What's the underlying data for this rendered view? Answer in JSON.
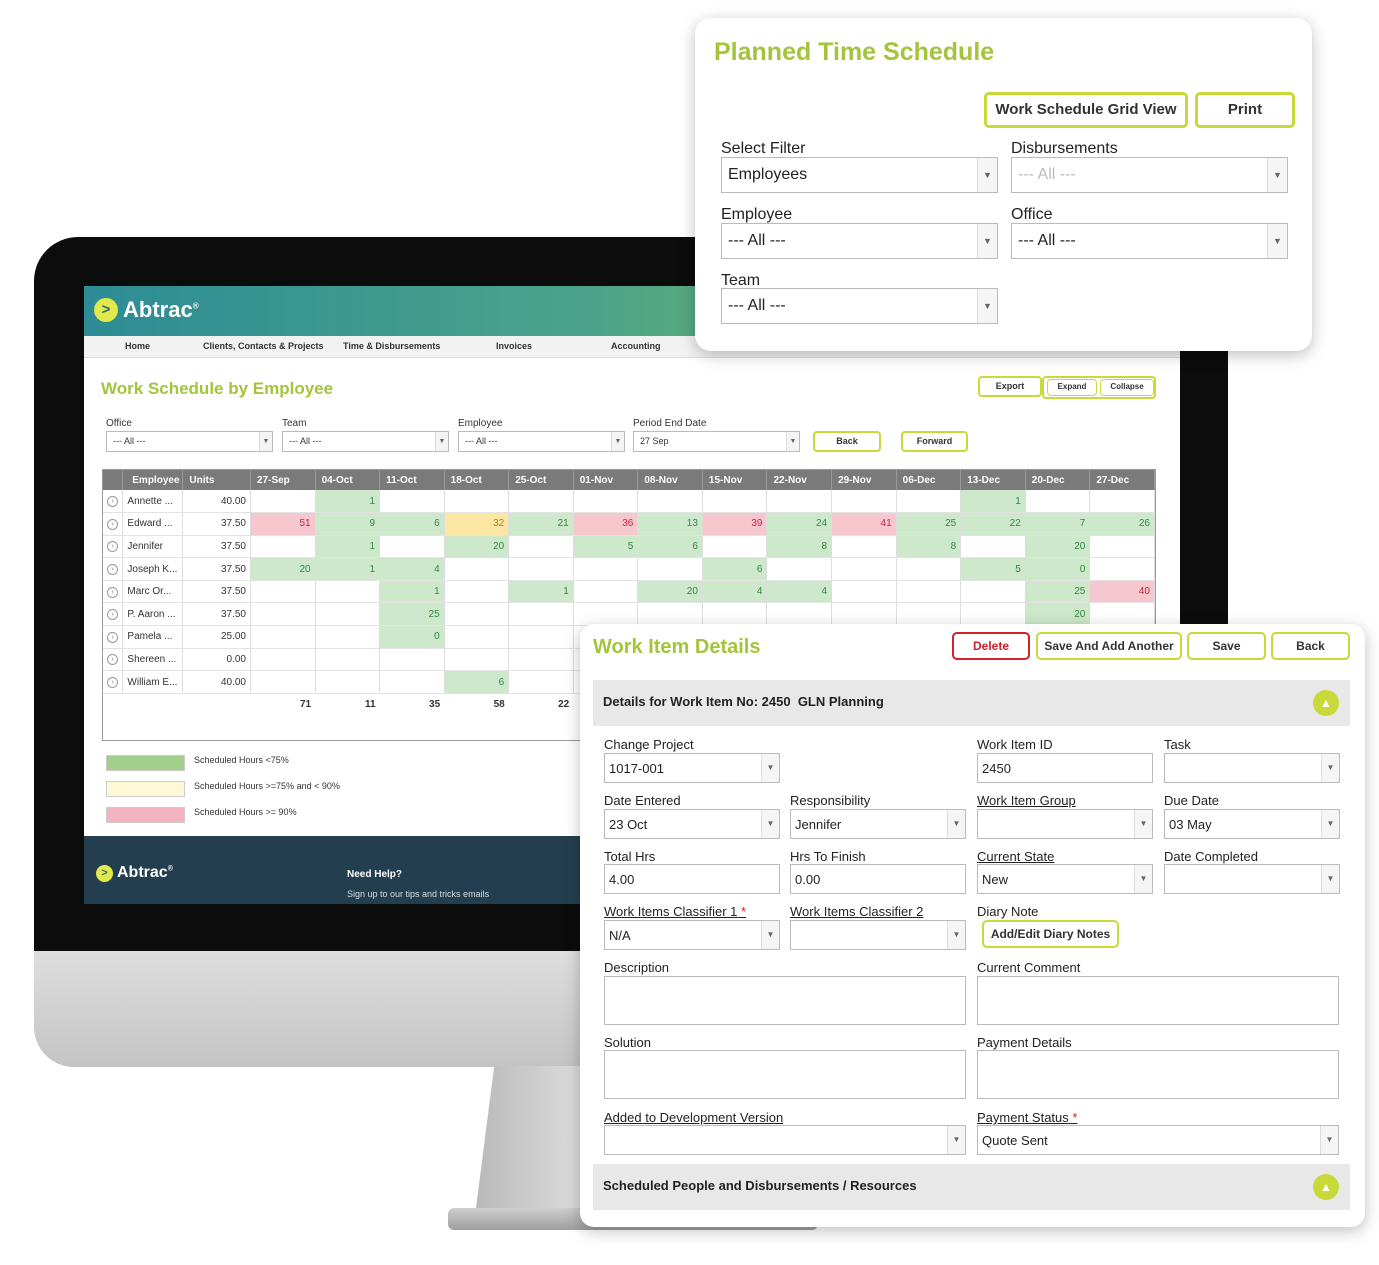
{
  "brand": {
    "name": "Abtrac",
    "reg": "®"
  },
  "nav": [
    "Home",
    "Clients, Contacts & Projects",
    "Time & Disbursements",
    "Invoices",
    "Accounting"
  ],
  "schedule": {
    "title": "Work Schedule by Employee",
    "buttons": {
      "export": "Export",
      "expand": "Expand",
      "collapse": "Collapse",
      "back": "Back",
      "forward": "Forward"
    },
    "filters": [
      {
        "label": "Office",
        "value": "--- All ---"
      },
      {
        "label": "Team",
        "value": "--- All ---"
      },
      {
        "label": "Employee",
        "value": "--- All ---"
      },
      {
        "label": "Period End Date",
        "value": "27 Sep"
      }
    ],
    "columns": [
      "Employee",
      "Units",
      "27-Sep",
      "04-Oct",
      "11-Oct",
      "18-Oct",
      "25-Oct",
      "01-Nov",
      "08-Nov",
      "15-Nov",
      "22-Nov",
      "29-Nov",
      "06-Dec",
      "13-Dec",
      "20-Dec",
      "27-Dec"
    ],
    "rows": [
      {
        "name": "Annette ...",
        "units": "40.00",
        "cells": [
          [
            "",
            ""
          ],
          [
            "1",
            "g"
          ],
          [
            "",
            ""
          ],
          [
            "",
            ""
          ],
          [
            "",
            ""
          ],
          [
            "",
            ""
          ],
          [
            "",
            ""
          ],
          [
            "",
            ""
          ],
          [
            "",
            ""
          ],
          [
            "",
            ""
          ],
          [
            "",
            ""
          ],
          [
            "1",
            "g"
          ],
          [
            "",
            ""
          ],
          [
            "",
            ""
          ]
        ]
      },
      {
        "name": "Edward ...",
        "units": "37.50",
        "cells": [
          [
            "51",
            "r"
          ],
          [
            "9",
            "g"
          ],
          [
            "6",
            "g"
          ],
          [
            "32",
            "y"
          ],
          [
            "21",
            "g"
          ],
          [
            "36",
            "r"
          ],
          [
            "13",
            "g"
          ],
          [
            "39",
            "r"
          ],
          [
            "24",
            "g"
          ],
          [
            "41",
            "r"
          ],
          [
            "25",
            "g"
          ],
          [
            "22",
            "g"
          ],
          [
            "7",
            "g"
          ],
          [
            "26",
            "g"
          ]
        ]
      },
      {
        "name": "Jennifer",
        "units": "37.50",
        "cells": [
          [
            "",
            ""
          ],
          [
            "1",
            "g"
          ],
          [
            "",
            ""
          ],
          [
            "20",
            "g"
          ],
          [
            "",
            ""
          ],
          [
            "5",
            "g"
          ],
          [
            "6",
            "g"
          ],
          [
            "",
            ""
          ],
          [
            "8",
            "g"
          ],
          [
            "",
            ""
          ],
          [
            "8",
            "g"
          ],
          [
            "",
            ""
          ],
          [
            "20",
            "g"
          ],
          [
            "",
            ""
          ]
        ]
      },
      {
        "name": "Joseph K...",
        "units": "37.50",
        "cells": [
          [
            "20",
            "g"
          ],
          [
            "1",
            "g"
          ],
          [
            "4",
            "g"
          ],
          [
            "",
            ""
          ],
          [
            "",
            ""
          ],
          [
            "",
            ""
          ],
          [
            "",
            ""
          ],
          [
            "6",
            "g"
          ],
          [
            "",
            ""
          ],
          [
            "",
            ""
          ],
          [
            "",
            ""
          ],
          [
            "5",
            "g"
          ],
          [
            "0",
            "g"
          ],
          [
            "",
            ""
          ]
        ]
      },
      {
        "name": "Marc Or...",
        "units": "37.50",
        "cells": [
          [
            "",
            ""
          ],
          [
            "",
            ""
          ],
          [
            "1",
            "g"
          ],
          [
            "",
            ""
          ],
          [
            "1",
            "g"
          ],
          [
            "",
            ""
          ],
          [
            "20",
            "g"
          ],
          [
            "4",
            "g"
          ],
          [
            "4",
            "g"
          ],
          [
            "",
            ""
          ],
          [
            "",
            ""
          ],
          [
            "",
            ""
          ],
          [
            "25",
            "g"
          ],
          [
            "40",
            "r"
          ]
        ]
      },
      {
        "name": "P. Aaron ...",
        "units": "37.50",
        "cells": [
          [
            "",
            ""
          ],
          [
            "",
            ""
          ],
          [
            "25",
            "g"
          ],
          [
            "",
            ""
          ],
          [
            "",
            ""
          ],
          [
            "",
            ""
          ],
          [
            "",
            ""
          ],
          [
            "",
            ""
          ],
          [
            "",
            ""
          ],
          [
            "",
            ""
          ],
          [
            "",
            ""
          ],
          [
            "",
            ""
          ],
          [
            "20",
            "g"
          ],
          [
            "",
            ""
          ]
        ]
      },
      {
        "name": "Pamela ...",
        "units": "25.00",
        "cells": [
          [
            "",
            ""
          ],
          [
            "",
            ""
          ],
          [
            "0",
            "g"
          ],
          [
            "",
            ""
          ],
          [
            "",
            ""
          ],
          [
            "",
            ""
          ],
          [
            "",
            ""
          ],
          [
            "",
            ""
          ],
          [
            "",
            ""
          ],
          [
            "",
            ""
          ],
          [
            "",
            ""
          ],
          [
            "",
            ""
          ],
          [
            "",
            ""
          ],
          [
            "",
            ""
          ]
        ]
      },
      {
        "name": "Shereen ...",
        "units": "0.00",
        "cells": [
          [
            "",
            ""
          ],
          [
            "",
            ""
          ],
          [
            "",
            ""
          ],
          [
            "",
            ""
          ],
          [
            "",
            ""
          ],
          [
            "",
            ""
          ],
          [
            "",
            ""
          ],
          [
            "",
            ""
          ],
          [
            "",
            ""
          ],
          [
            "",
            ""
          ],
          [
            "",
            ""
          ],
          [
            "",
            ""
          ],
          [
            "",
            ""
          ],
          [
            "",
            ""
          ]
        ]
      },
      {
        "name": "William E...",
        "units": "40.00",
        "cells": [
          [
            "",
            ""
          ],
          [
            "",
            ""
          ],
          [
            "",
            ""
          ],
          [
            "6",
            "g"
          ],
          [
            "",
            ""
          ],
          [
            "",
            ""
          ],
          [
            "",
            ""
          ],
          [
            "",
            ""
          ],
          [
            "",
            ""
          ],
          [
            "",
            ""
          ],
          [
            "",
            ""
          ],
          [
            "",
            ""
          ],
          [
            "",
            ""
          ],
          [
            "",
            ""
          ]
        ]
      }
    ],
    "totals": [
      "71",
      "11",
      "35",
      "58",
      "22",
      "",
      "",
      "",
      "",
      "",
      "",
      "",
      "",
      ""
    ],
    "legend": [
      {
        "label": "Scheduled Hours <75%",
        "color": "#a3cf8c"
      },
      {
        "label": "Scheduled Hours >=75% and < 90%",
        "color": "#fdf8d6"
      },
      {
        "label": "Scheduled Hours >= 90%",
        "color": "#f4b3c0"
      }
    ],
    "footer": {
      "help_title": "Need Help?",
      "help_text": "Sign up to our tips and tricks emails"
    }
  },
  "planned": {
    "title": "Planned Time Schedule",
    "buttons": {
      "grid_view": "Work Schedule Grid View",
      "print": "Print"
    },
    "fields": {
      "select_filter": {
        "label": "Select Filter",
        "value": "Employees"
      },
      "disbursements": {
        "label": "Disbursements",
        "value": "--- All ---"
      },
      "employee": {
        "label": "Employee",
        "value": "--- All ---"
      },
      "office": {
        "label": "Office",
        "value": "--- All ---"
      },
      "team": {
        "label": "Team",
        "value": "--- All ---"
      }
    }
  },
  "work_item": {
    "title": "Work Item Details",
    "buttons": {
      "delete": "Delete",
      "save_add": "Save And Add Another",
      "save": "Save",
      "back": "Back"
    },
    "section1": "Details for Work Item No: 2450  GLN Planning",
    "section2": "Scheduled People and Disbursements / Resources",
    "fields": {
      "change_project": {
        "label": "Change Project",
        "value": "1017-001"
      },
      "work_item_id": {
        "label": "Work Item ID",
        "value": "2450"
      },
      "task": {
        "label": "Task",
        "value": ""
      },
      "date_entered": {
        "label": "Date Entered",
        "value": "23 Oct"
      },
      "responsibility": {
        "label": "Responsibility",
        "value": "Jennifer"
      },
      "work_item_group": {
        "label": "Work Item Group",
        "value": ""
      },
      "due_date": {
        "label": "Due Date",
        "value": "03 May"
      },
      "total_hrs": {
        "label": "Total Hrs",
        "value": "4.00"
      },
      "hrs_to_finish": {
        "label": "Hrs To Finish",
        "value": "0.00"
      },
      "current_state": {
        "label": "Current State",
        "value": "New"
      },
      "date_completed": {
        "label": "Date Completed",
        "value": ""
      },
      "classifier1": {
        "label": "Work Items Classifier 1",
        "value": "N/A"
      },
      "classifier2": {
        "label": "Work Items Classifier 2",
        "value": ""
      },
      "diary_note": {
        "label": "Diary Note",
        "button": "Add/Edit Diary Notes"
      },
      "description": {
        "label": "Description"
      },
      "current_comment": {
        "label": "Current Comment"
      },
      "solution": {
        "label": "Solution"
      },
      "payment_details": {
        "label": "Payment Details"
      },
      "dev_version": {
        "label": "Added to Development Version",
        "value": ""
      },
      "payment_status": {
        "label": "Payment Status",
        "value": "Quote Sent"
      }
    }
  }
}
